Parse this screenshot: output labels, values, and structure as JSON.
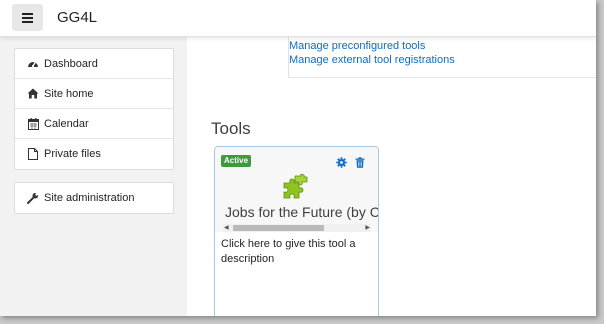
{
  "header": {
    "site_name": "GG4L",
    "menu_icon": "hamburger-icon"
  },
  "sidebar": {
    "items": [
      {
        "label": "Dashboard",
        "icon": "tachometer-icon"
      },
      {
        "label": "Site home",
        "icon": "home-icon"
      },
      {
        "label": "Calendar",
        "icon": "calendar-icon"
      },
      {
        "label": "Private files",
        "icon": "file-icon"
      }
    ],
    "admin_items": [
      {
        "label": "Site administration",
        "icon": "wrench-icon"
      }
    ]
  },
  "main": {
    "links": [
      "Manage preconfigured tools",
      "Manage external tool registrations"
    ],
    "tools_heading": "Tools",
    "tool_card": {
      "status": "Active",
      "status_color": "#3d9a3d",
      "name": "Jobs for the Future (by C",
      "description": "Click here to give this tool a description",
      "icons": [
        "gear-icon",
        "trash-icon",
        "puzzle-icon"
      ],
      "accent_color": "#0f6cbf"
    }
  }
}
